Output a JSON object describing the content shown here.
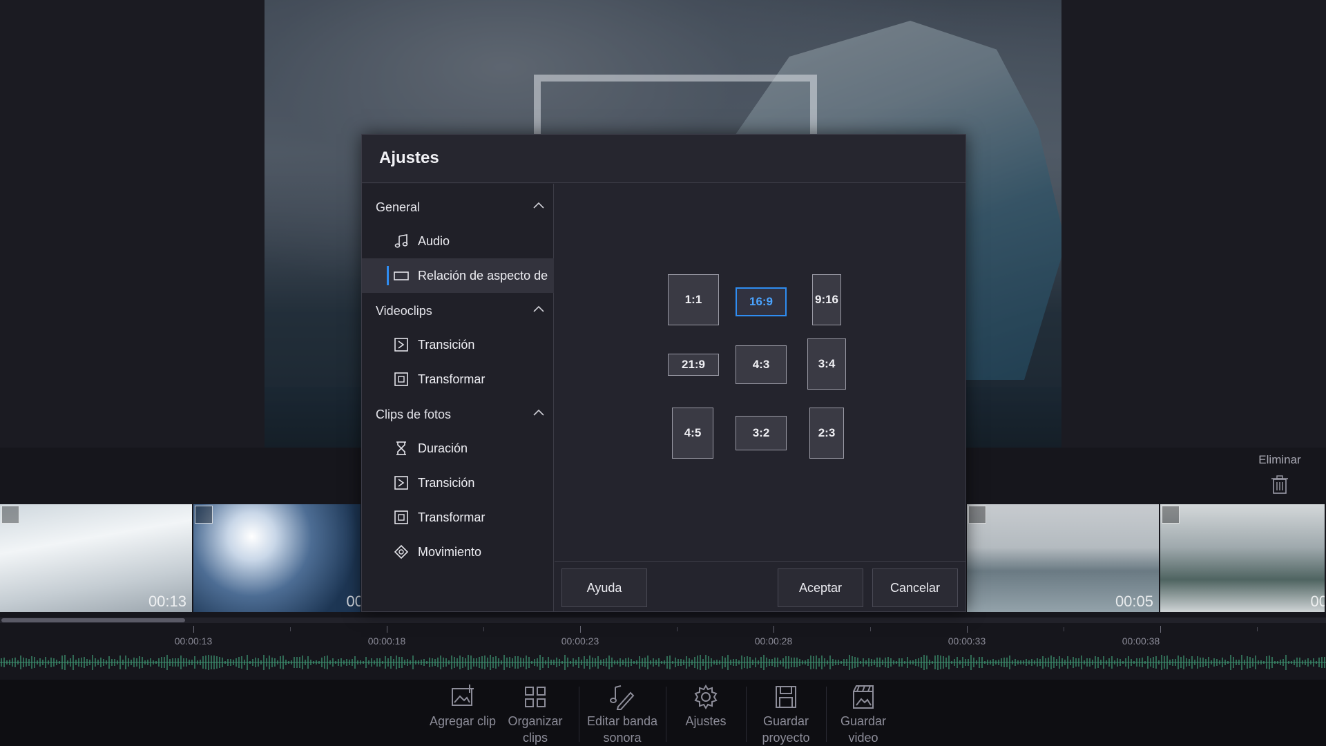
{
  "dialog": {
    "title": "Ajustes",
    "nav": {
      "groups": [
        {
          "label": "General",
          "items": [
            {
              "label": "Audio",
              "icon": "music-note-icon"
            },
            {
              "label": "Relación de aspecto de",
              "icon": "aspect-ratio-icon",
              "active": true
            }
          ]
        },
        {
          "label": "Videoclips",
          "items": [
            {
              "label": "Transición",
              "icon": "transition-icon"
            },
            {
              "label": "Transformar",
              "icon": "transform-icon"
            }
          ]
        },
        {
          "label": "Clips de fotos",
          "items": [
            {
              "label": "Duración",
              "icon": "hourglass-icon"
            },
            {
              "label": "Transición",
              "icon": "transition-icon"
            },
            {
              "label": "Transformar",
              "icon": "transform-icon"
            },
            {
              "label": "Movimiento",
              "icon": "motion-icon"
            }
          ]
        }
      ]
    },
    "ratios": [
      "1:1",
      "16:9",
      "9:16",
      "21:9",
      "4:3",
      "3:4",
      "4:5",
      "3:2",
      "2:3"
    ],
    "selected_ratio": "16:9",
    "buttons": {
      "help": "Ayuda",
      "accept": "Aceptar",
      "cancel": "Cancelar"
    }
  },
  "timeline": {
    "delete_label": "Eliminar",
    "clips": [
      {
        "duration": "00:13"
      },
      {
        "duration": "00"
      },
      {
        "duration": "00:05"
      },
      {
        "duration": "00"
      }
    ],
    "ruler": [
      "00:00:13",
      "00:00:18",
      "00:00:23",
      "00:00:28",
      "00:00:33",
      "00:00:38"
    ]
  },
  "toolbar": {
    "add_clip": "Agregar clip",
    "organize_line1": "Organizar",
    "organize_line2": "clips",
    "soundtrack_line1": "Editar banda",
    "soundtrack_line2": "sonora",
    "settings": "Ajustes",
    "save_project_line1": "Guardar",
    "save_project_line2": "proyecto",
    "save_video_line1": "Guardar",
    "save_video_line2": "video"
  },
  "colors": {
    "accent": "#2f8df2",
    "background": "#1b1b22",
    "dialog": "#24242d",
    "waveform": "#3c8f6e"
  }
}
